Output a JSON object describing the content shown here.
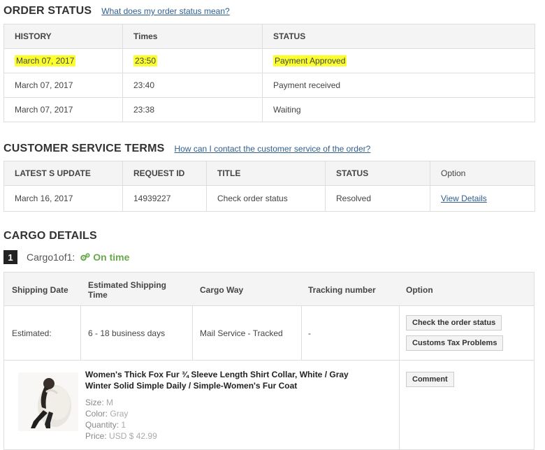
{
  "order_status": {
    "title": "ORDER STATUS",
    "help_link": "What does my order status mean?",
    "columns": [
      "HISTORY",
      "Times",
      "STATUS"
    ],
    "rows": [
      {
        "date": "March 07, 2017",
        "time": "23:50",
        "status": "Payment Approved",
        "highlighted": true
      },
      {
        "date": "March 07, 2017",
        "time": "23:40",
        "status": "Payment received",
        "highlighted": false
      },
      {
        "date": "March 07, 2017",
        "time": "23:38",
        "status": "Waiting",
        "highlighted": false
      }
    ]
  },
  "customer_service": {
    "title": "CUSTOMER SERVICE TERMS",
    "help_link": "How can I contact the customer service of the order?",
    "columns": [
      "LATEST S UPDATE",
      "REQUEST ID",
      "TITLE",
      "STATUS",
      "Option"
    ],
    "row": {
      "update": "March 16, 2017",
      "request_id": "14939227",
      "title": "Check order status",
      "status": "Resolved",
      "option_link": "View Details"
    }
  },
  "cargo": {
    "title": "CARGO DETAILS",
    "number": "1",
    "label": "Cargo1of1:",
    "status": "On time",
    "status_icon": "gears-icon",
    "columns": {
      "shipping_date": "Shipping Date",
      "estimated_time": "Estimated Shipping Time",
      "cargo_way": "Cargo Way",
      "tracking": "Tracking number",
      "option": "Option"
    },
    "row": {
      "shipping_date": "Estimated:",
      "estimated_time": "6 - 18 business days",
      "cargo_way": "Mail Service - Tracked",
      "tracking": "-",
      "buttons": [
        "Check the order status",
        "Customs Tax Problems"
      ]
    },
    "product": {
      "title": "Women's Thick Fox Fur ¾ Sleeve Length Shirt Collar, White / Gray Winter Solid Simple Daily / Simple-Women's Fur Coat",
      "size_label": "Size:",
      "size": "M",
      "color_label": "Color:",
      "color": "Gray",
      "quantity_label": "Quantity:",
      "quantity": "1",
      "price_label": "Price:",
      "price": "USD $ 42.99",
      "comment_button": "Comment"
    }
  },
  "colors": {
    "highlight": "#fbff2e",
    "on_time": "#6aa84f",
    "link": "#2f5f8f"
  }
}
